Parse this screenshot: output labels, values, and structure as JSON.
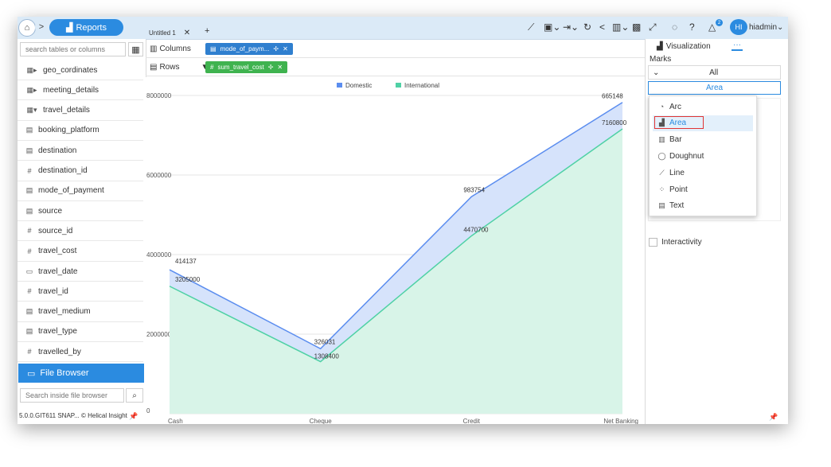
{
  "nav": {
    "home_icon": "home-icon",
    "forward_icon": "chevron-right-icon",
    "reports_label": "Reports"
  },
  "sidebar": {
    "search_placeholder": "search tables or columns",
    "fields": [
      {
        "icon": "table-icon",
        "label": "geo_cordinates",
        "type": "table"
      },
      {
        "icon": "table-icon",
        "label": "meeting_details",
        "type": "table"
      },
      {
        "icon": "table-icon",
        "label": "travel_details",
        "type": "table-open"
      },
      {
        "icon": "text-icon",
        "label": "booking_platform",
        "type": "text"
      },
      {
        "icon": "text-icon",
        "label": "destination",
        "type": "text"
      },
      {
        "icon": "hash-icon",
        "label": "destination_id",
        "type": "number"
      },
      {
        "icon": "text-icon",
        "label": "mode_of_payment",
        "type": "text"
      },
      {
        "icon": "text-icon",
        "label": "source",
        "type": "text"
      },
      {
        "icon": "hash-icon",
        "label": "source_id",
        "type": "number"
      },
      {
        "icon": "hash-icon",
        "label": "travel_cost",
        "type": "number"
      },
      {
        "icon": "calendar-icon",
        "label": "travel_date",
        "type": "date"
      },
      {
        "icon": "hash-icon",
        "label": "travel_id",
        "type": "number"
      },
      {
        "icon": "text-icon",
        "label": "travel_medium",
        "type": "text"
      },
      {
        "icon": "text-icon",
        "label": "travel_type",
        "type": "text"
      },
      {
        "icon": "hash-icon",
        "label": "travelled_by",
        "type": "number"
      }
    ],
    "file_browser_label": "File Browser",
    "file_search_placeholder": "Search inside file browser",
    "version": "5.0.0.GIT611 SNAP...",
    "brand": "© Helical Insight"
  },
  "header": {
    "tab_label": "Untitled 1",
    "username": "hiadmin",
    "avatar_initials": "HI",
    "notification_count": "2"
  },
  "shelves": {
    "columns_label": "Columns",
    "columns_pill": "mode_of_paym...",
    "rows_label": "Rows",
    "rows_pill": "sum_travel_cost"
  },
  "right_panel": {
    "viz_label": "Visualization",
    "more_label": "···",
    "marks_label": "Marks",
    "marks_all": "All",
    "marks_selected": "Area",
    "interactivity_label": "Interactivity",
    "options": [
      {
        "icon": "arc-icon",
        "label": "Arc"
      },
      {
        "icon": "area-icon",
        "label": "Area"
      },
      {
        "icon": "bar-icon",
        "label": "Bar"
      },
      {
        "icon": "doughnut-icon",
        "label": "Doughnut"
      },
      {
        "icon": "line-icon",
        "label": "Line"
      },
      {
        "icon": "point-icon",
        "label": "Point"
      },
      {
        "icon": "text-icon",
        "label": "Text"
      }
    ]
  },
  "colors": {
    "accent": "#2b8be0",
    "domestic": "#5b8def",
    "international": "#4fd1a5",
    "selection": "#e03434",
    "columns_pill": "#2f7fcf",
    "rows_pill": "#3fb34f"
  },
  "chart_data": {
    "type": "area",
    "categories": [
      "Cash",
      "Cheque",
      "Credit",
      "Net Banking"
    ],
    "series": [
      {
        "name": "Domestic",
        "values": [
          3619137,
          1634431,
          5454454,
          7825948
        ],
        "labels": [
          "414137",
          "326031",
          "983754",
          "665148"
        ]
      },
      {
        "name": "International",
        "values": [
          3205000,
          1308400,
          4470700,
          7160800
        ],
        "labels": [
          "3205000",
          "1308400",
          "4470700",
          "7160800"
        ]
      }
    ],
    "y_ticks": [
      "0",
      "2000000",
      "4000000",
      "6000000",
      "8000000"
    ],
    "ylim": [
      0,
      8000000
    ],
    "legend": "top-center",
    "grid": true
  }
}
